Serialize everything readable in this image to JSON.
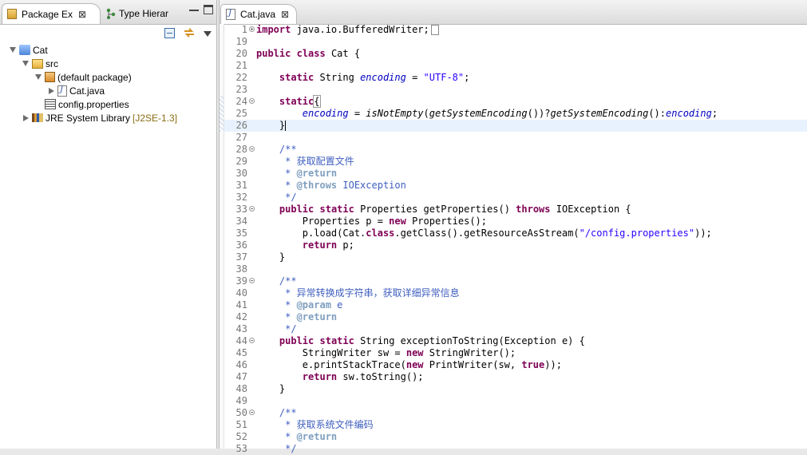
{
  "package_explorer": {
    "tabs": [
      {
        "label": "Package Ex"
      },
      {
        "label": "Type Hierar"
      }
    ],
    "tree": [
      {
        "label": "Cat",
        "depth": 0,
        "expanded": true,
        "icon": "java-project-icon"
      },
      {
        "label": "src",
        "depth": 1,
        "expanded": true,
        "icon": "source-folder-icon"
      },
      {
        "label": "(default package)",
        "depth": 2,
        "expanded": true,
        "icon": "package-icon"
      },
      {
        "label": "Cat.java",
        "depth": 3,
        "expanded": false,
        "icon": "java-file-icon"
      },
      {
        "label": "config.properties",
        "depth": 2,
        "icon": "properties-file-icon"
      },
      {
        "label": "JRE System Library",
        "tag": "[J2SE-1.3]",
        "depth": 0,
        "expanded": false,
        "icon": "library-icon"
      }
    ]
  },
  "editor": {
    "tab_label": "Cat.java",
    "current_line": 26,
    "lines": [
      {
        "n": "1",
        "t": "import java.io.BufferedWriter;"
      },
      {
        "n": "19",
        "t": ""
      },
      {
        "n": "20",
        "t": "public class Cat {"
      },
      {
        "n": "21",
        "t": ""
      },
      {
        "n": "22",
        "t": "    static String encoding = \"UTF-8\";"
      },
      {
        "n": "23",
        "t": ""
      },
      {
        "n": "24",
        "t": "    static{"
      },
      {
        "n": "25",
        "t": "        encoding = isNotEmpty(getSystemEncoding())?getSystemEncoding():encoding;"
      },
      {
        "n": "26",
        "t": "    }"
      },
      {
        "n": "27",
        "t": ""
      },
      {
        "n": "28",
        "t": "    /**"
      },
      {
        "n": "29",
        "t": "     * 获取配置文件"
      },
      {
        "n": "30",
        "t": "     * @return"
      },
      {
        "n": "31",
        "t": "     * @throws IOException"
      },
      {
        "n": "32",
        "t": "     */"
      },
      {
        "n": "33",
        "t": "    public static Properties getProperties() throws IOException {"
      },
      {
        "n": "34",
        "t": "        Properties p = new Properties();"
      },
      {
        "n": "35",
        "t": "        p.load(Cat.class.getClass().getResourceAsStream(\"/config.properties\"));"
      },
      {
        "n": "36",
        "t": "        return p;"
      },
      {
        "n": "37",
        "t": "    }"
      },
      {
        "n": "38",
        "t": ""
      },
      {
        "n": "39",
        "t": "    /**"
      },
      {
        "n": "40",
        "t": "     * 异常转换成字符串，获取详细异常信息"
      },
      {
        "n": "41",
        "t": "     * @param e"
      },
      {
        "n": "42",
        "t": "     * @return"
      },
      {
        "n": "43",
        "t": "     */"
      },
      {
        "n": "44",
        "t": "    public static String exceptionToString(Exception e) {"
      },
      {
        "n": "45",
        "t": "        StringWriter sw = new StringWriter();"
      },
      {
        "n": "46",
        "t": "        e.printStackTrace(new PrintWriter(sw, true));"
      },
      {
        "n": "47",
        "t": "        return sw.toString();"
      },
      {
        "n": "48",
        "t": "    }"
      },
      {
        "n": "49",
        "t": ""
      },
      {
        "n": "50",
        "t": "    /**"
      },
      {
        "n": "51",
        "t": "     * 获取系统文件编码"
      },
      {
        "n": "52",
        "t": "     * @return"
      },
      {
        "n": "53",
        "t": "     */"
      }
    ]
  }
}
